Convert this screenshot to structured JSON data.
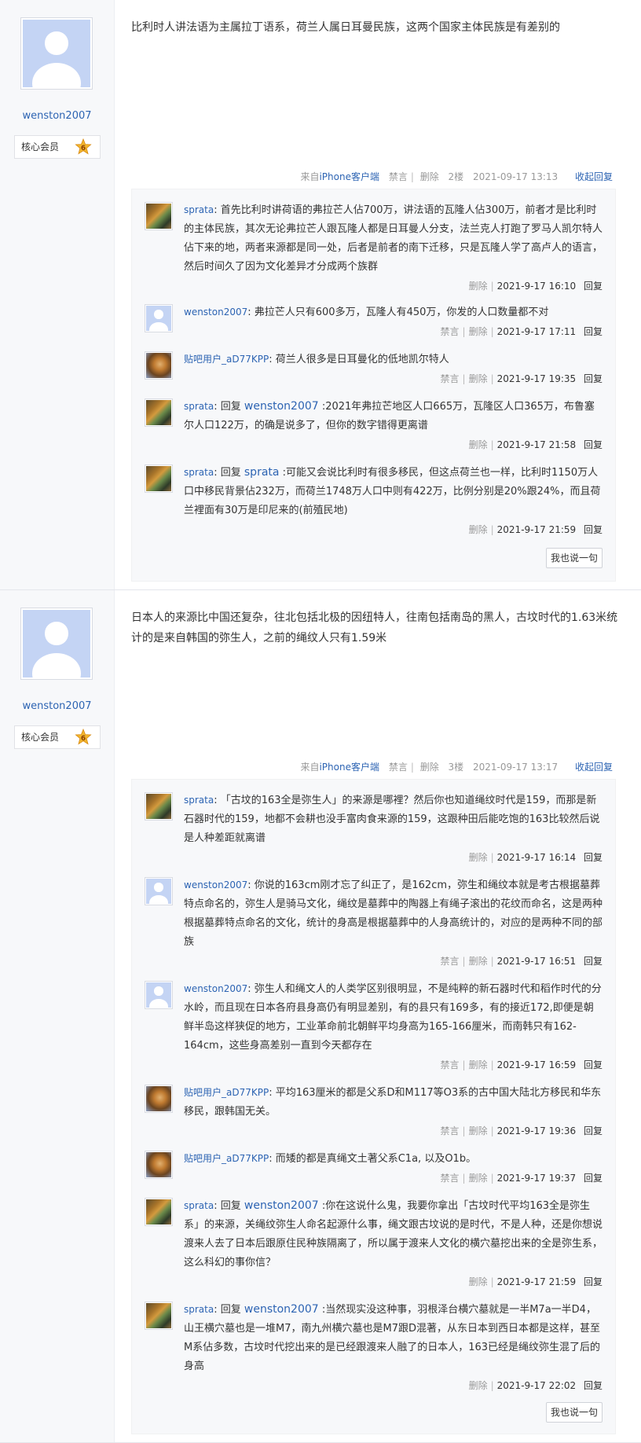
{
  "posts": [
    {
      "username": "wenston2007",
      "member_label": "核心会员",
      "member_level": "6",
      "content": "比利时人讲法语为主属拉丁语系，荷兰人属日耳曼民族，这两个国家主体民族是有差别的",
      "tail": {
        "source_prefix": "来自",
        "source_link": "iPhone客户端",
        "ban": "禁言",
        "delete": "删除",
        "floor": "2楼",
        "time": "2021-09-17 13:13",
        "toggle": "收起回复"
      },
      "say_button": "我也说一句",
      "replies": [
        {
          "avatar": "photo1",
          "user": "sprata",
          "reply_word": "",
          "target": "",
          "text": "首先比利时讲荷语的弗拉芒人佔700万，讲法语的瓦隆人佔300万，前者才是比利时的主体民族，其次无论弗拉芒人跟瓦隆人都是日耳曼人分支，法兰克人打跑了罗马人凯尔特人佔下来的地，两者来源都是同一处，后者是前者的南下迁移，只是瓦隆人学了高卢人的语言，然后时间久了因为文化差异才分成两个族群",
          "ban": "",
          "delete": "删除",
          "time": "2021-9-17 16:10",
          "reply": "回复"
        },
        {
          "avatar": "blank",
          "user": "wenston2007",
          "reply_word": "",
          "target": "",
          "text": "弗拉芒人只有600多万，瓦隆人有450万，你发的人口数量都不对",
          "ban": "禁言",
          "delete": "删除",
          "time": "2021-9-17 17:11",
          "reply": "回复"
        },
        {
          "avatar": "photo2",
          "user": "贴吧用户_aD77KPP",
          "reply_word": "",
          "target": "",
          "text": "荷兰人很多是日耳曼化的低地凯尔特人",
          "ban": "禁言",
          "delete": "删除",
          "time": "2021-9-17 19:35",
          "reply": "回复"
        },
        {
          "avatar": "photo1",
          "user": "sprata",
          "reply_word": "回复",
          "target": "wenston2007",
          "text": ":2021年弗拉芒地区人口665万，瓦隆区人口365万，布鲁塞尔人口122万，的确是说多了，但你的数字错得更离谱",
          "ban": "",
          "delete": "删除",
          "time": "2021-9-17 21:58",
          "reply": "回复"
        },
        {
          "avatar": "photo1",
          "user": "sprata",
          "reply_word": "回复",
          "target": "sprata",
          "text": ":可能又会说比利时有很多移民，但这点荷兰也一样，比利时1150万人口中移民背景佔232万，而荷兰1748万人口中则有422万，比例分别是20%跟24%，而且荷兰裡面有30万是印尼来的(前殖民地)",
          "ban": "",
          "delete": "删除",
          "time": "2021-9-17 21:59",
          "reply": "回复"
        }
      ]
    },
    {
      "username": "wenston2007",
      "member_label": "核心会员",
      "member_level": "6",
      "content": "日本人的来源比中国还复杂，往北包括北极的因纽特人，往南包括南岛的黑人，古坟时代的1.63米统计的是来自韩国的弥生人，之前的绳纹人只有1.59米",
      "tail": {
        "source_prefix": "来自",
        "source_link": "iPhone客户端",
        "ban": "禁言",
        "delete": "删除",
        "floor": "3楼",
        "time": "2021-09-17 13:17",
        "toggle": "收起回复"
      },
      "say_button": "我也说一句",
      "replies": [
        {
          "avatar": "photo1",
          "user": "sprata",
          "reply_word": "",
          "target": "",
          "text": "「古坟的163全是弥生人」的来源是哪裡？然后你也知道绳纹时代是159，而那是新石器时代的159，地都不会耕也没手富肉食来源的159，这跟种田后能吃饱的163比较然后说是人种差距就离谱",
          "ban": "",
          "delete": "删除",
          "time": "2021-9-17 16:14",
          "reply": "回复"
        },
        {
          "avatar": "blank",
          "user": "wenston2007",
          "reply_word": "",
          "target": "",
          "text": "你说的163cm刚才忘了纠正了，是162cm，弥生和绳纹本就是考古根据墓葬特点命名的，弥生人是骑马文化，绳纹是墓葬中的陶器上有绳子滚出的花纹而命名，这是两种根据墓葬特点命名的文化，统计的身高是根据墓葬中的人身高统计的，对应的是两种不同的部族",
          "ban": "禁言",
          "delete": "删除",
          "time": "2021-9-17 16:51",
          "reply": "回复"
        },
        {
          "avatar": "blank",
          "user": "wenston2007",
          "reply_word": "",
          "target": "",
          "text": "弥生人和绳文人的人类学区别很明显，不是纯粹的新石器时代和稻作时代的分水岭，而且现在日本各府县身高仍有明显差别，有的县只有169多，有的接近172,即便是朝鲜半岛这样狭促的地方，工业革命前北朝鲜平均身高为165-166厘米，而南韩只有162-164cm，这些身高差别一直到今天都存在",
          "ban": "禁言",
          "delete": "删除",
          "time": "2021-9-17 16:59",
          "reply": "回复"
        },
        {
          "avatar": "photo2",
          "user": "贴吧用户_aD77KPP",
          "reply_word": "",
          "target": "",
          "text": "平均163厘米的都是父系D和M117等O3系的古中国大陆北方移民和华东移民，跟韩国无关。",
          "ban": "禁言",
          "delete": "删除",
          "time": "2021-9-17 19:36",
          "reply": "回复"
        },
        {
          "avatar": "photo2",
          "user": "贴吧用户_aD77KPP",
          "reply_word": "",
          "target": "",
          "text": "而矮的都是真绳文土著父系C1a, 以及O1b。",
          "ban": "禁言",
          "delete": "删除",
          "time": "2021-9-17 19:37",
          "reply": "回复"
        },
        {
          "avatar": "photo1",
          "user": "sprata",
          "reply_word": "回复",
          "target": "wenston2007",
          "text": ":你在这说什么鬼，我要你拿出「古坟时代平均163全是弥生系」的来源，关绳纹弥生人命名起源什么事，绳文跟古坟说的是时代，不是人种，还是你想说渡来人去了日本后跟原住民种族隔离了，所以属于渡来人文化的横穴墓挖出来的全是弥生系，这么科幻的事你信？",
          "ban": "",
          "delete": "删除",
          "time": "2021-9-17 21:59",
          "reply": "回复"
        },
        {
          "avatar": "photo1",
          "user": "sprata",
          "reply_word": "回复",
          "target": "wenston2007",
          "text": ":当然现实没这种事，羽根泽台横穴墓就是一半M7a一半D4，山王横穴墓也是一堆M7，南九州横穴墓也是M7跟D混著，从东日本到西日本都是这样，甚至M系佔多数，古坟时代挖出来的是已经跟渡来人融了的日本人，163已经是绳纹弥生混了后的身高",
          "ban": "",
          "delete": "删除",
          "time": "2021-9-17 22:02",
          "reply": "回复"
        }
      ]
    }
  ]
}
